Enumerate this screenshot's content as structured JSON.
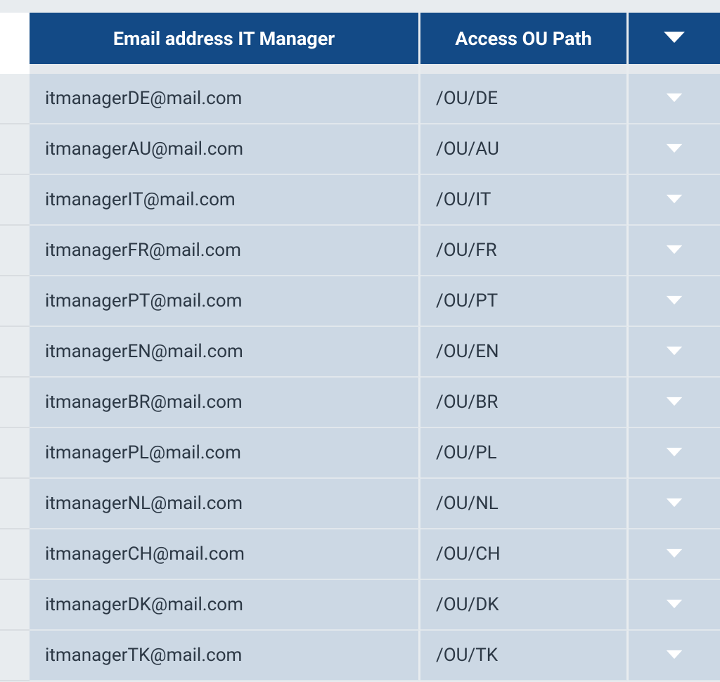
{
  "table": {
    "headers": {
      "email": "Email address IT Manager",
      "path": "Access OU Path",
      "action_icon": "chevron-down"
    },
    "rows": [
      {
        "email": "itmanagerDE@mail.com",
        "path": "/OU/DE"
      },
      {
        "email": "itmanagerAU@mail.com",
        "path": "/OU/AU"
      },
      {
        "email": "itmanagerIT@mail.com",
        "path": "/OU/IT"
      },
      {
        "email": "itmanagerFR@mail.com",
        "path": "/OU/FR"
      },
      {
        "email": "itmanagerPT@mail.com",
        "path": "/OU/PT"
      },
      {
        "email": "itmanagerEN@mail.com",
        "path": "/OU/EN"
      },
      {
        "email": "itmanagerBR@mail.com",
        "path": "/OU/BR"
      },
      {
        "email": "itmanagerPL@mail.com",
        "path": "/OU/PL"
      },
      {
        "email": "itmanagerNL@mail.com",
        "path": "/OU/NL"
      },
      {
        "email": "itmanagerCH@mail.com",
        "path": "/OU/CH"
      },
      {
        "email": "itmanagerDK@mail.com",
        "path": "/OU/DK"
      },
      {
        "email": "itmanagerTK@mail.com",
        "path": "/OU/TK"
      }
    ]
  }
}
